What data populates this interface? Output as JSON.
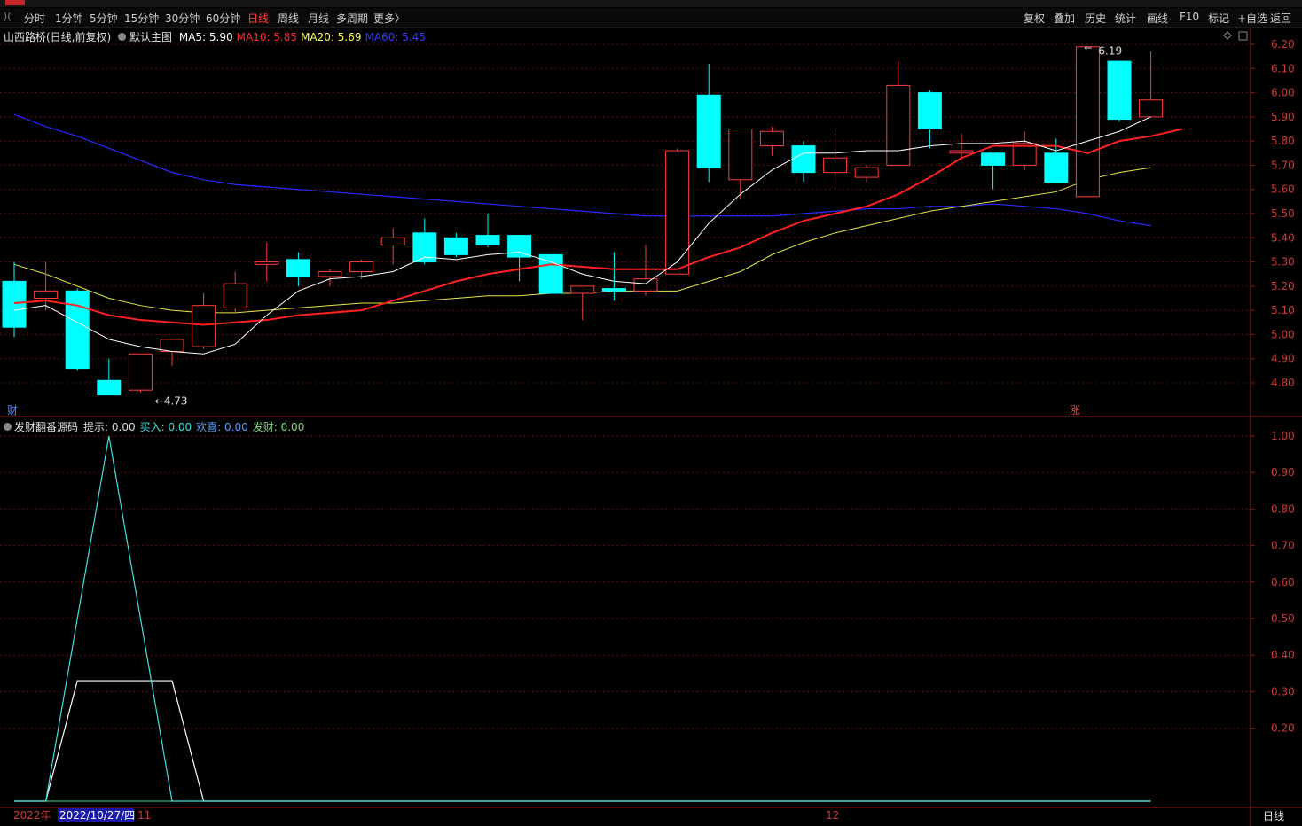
{
  "toolbar": {
    "back_label": "⟩(",
    "periods": [
      "分时",
      "1分钟",
      "5分钟",
      "15分钟",
      "30分钟",
      "60分钟",
      "日线",
      "周线",
      "月线",
      "多周期",
      "更多〉"
    ],
    "active_period": "日线",
    "right_buttons": [
      "复权",
      "叠加",
      "历史",
      "统计",
      "画线",
      "F10",
      "标记",
      "+自选",
      "返回"
    ]
  },
  "main_chart": {
    "stock_title": "山西路桥(日线,前复权)",
    "template_label": "默认主图",
    "ma": [
      {
        "label": "MA5: 5.90",
        "color": "#ffffff"
      },
      {
        "label": "MA10: 5.85",
        "color": "#ff2a2a"
      },
      {
        "label": "MA20: 5.69",
        "color": "#ffff55"
      },
      {
        "label": "MA60: 5.45",
        "color": "#3a3aff"
      }
    ],
    "high_label": "6.19",
    "low_label": "4.73",
    "marker_left": "财",
    "marker_right": "涨",
    "y_ticks": [
      "6.20",
      "6.10",
      "6.00",
      "5.90",
      "5.80",
      "5.70",
      "5.60",
      "5.50",
      "5.40",
      "5.30",
      "5.20",
      "5.10",
      "5.00",
      "4.90",
      "4.80"
    ]
  },
  "chart_data": {
    "type": "candlestick",
    "ylim": [
      4.7,
      6.22
    ],
    "candles": [
      {
        "o": 5.22,
        "h": 5.3,
        "l": 4.99,
        "c": 5.03
      },
      {
        "o": 5.15,
        "h": 5.3,
        "l": 5.1,
        "c": 5.18
      },
      {
        "o": 5.18,
        "h": 5.19,
        "l": 4.85,
        "c": 4.86
      },
      {
        "o": 4.81,
        "h": 4.9,
        "l": 4.75,
        "c": 4.75
      },
      {
        "o": 4.77,
        "h": 4.92,
        "l": 4.76,
        "c": 4.92
      },
      {
        "o": 4.93,
        "h": 4.98,
        "l": 4.87,
        "c": 4.98
      },
      {
        "o": 4.95,
        "h": 5.17,
        "l": 4.94,
        "c": 5.12
      },
      {
        "o": 5.11,
        "h": 5.26,
        "l": 5.09,
        "c": 5.21
      },
      {
        "o": 5.29,
        "h": 5.38,
        "l": 5.22,
        "c": 5.3
      },
      {
        "o": 5.31,
        "h": 5.34,
        "l": 5.2,
        "c": 5.24
      },
      {
        "o": 5.24,
        "h": 5.27,
        "l": 5.2,
        "c": 5.26
      },
      {
        "o": 5.26,
        "h": 5.31,
        "l": 5.23,
        "c": 5.3
      },
      {
        "o": 5.37,
        "h": 5.44,
        "l": 5.29,
        "c": 5.4
      },
      {
        "o": 5.42,
        "h": 5.48,
        "l": 5.29,
        "c": 5.3
      },
      {
        "o": 5.4,
        "h": 5.42,
        "l": 5.32,
        "c": 5.33
      },
      {
        "o": 5.41,
        "h": 5.5,
        "l": 5.36,
        "c": 5.37
      },
      {
        "o": 5.41,
        "h": 5.41,
        "l": 5.22,
        "c": 5.32
      },
      {
        "o": 5.33,
        "h": 5.33,
        "l": 5.17,
        "c": 5.17
      },
      {
        "o": 5.17,
        "h": 5.2,
        "l": 5.06,
        "c": 5.2
      },
      {
        "o": 5.19,
        "h": 5.34,
        "l": 5.14,
        "c": 5.18
      },
      {
        "o": 5.18,
        "h": 5.37,
        "l": 5.16,
        "c": 5.23
      },
      {
        "o": 5.25,
        "h": 5.77,
        "l": 5.25,
        "c": 5.76
      },
      {
        "o": 5.99,
        "h": 6.12,
        "l": 5.63,
        "c": 5.69
      },
      {
        "o": 5.64,
        "h": 5.85,
        "l": 5.56,
        "c": 5.85
      },
      {
        "o": 5.78,
        "h": 5.86,
        "l": 5.74,
        "c": 5.84
      },
      {
        "o": 5.78,
        "h": 5.8,
        "l": 5.63,
        "c": 5.67
      },
      {
        "o": 5.67,
        "h": 5.85,
        "l": 5.6,
        "c": 5.73
      },
      {
        "o": 5.65,
        "h": 5.7,
        "l": 5.63,
        "c": 5.69
      },
      {
        "o": 5.7,
        "h": 6.13,
        "l": 5.7,
        "c": 6.03
      },
      {
        "o": 6.0,
        "h": 6.01,
        "l": 5.77,
        "c": 5.85
      },
      {
        "o": 5.75,
        "h": 5.83,
        "l": 5.72,
        "c": 5.76
      },
      {
        "o": 5.75,
        "h": 5.75,
        "l": 5.6,
        "c": 5.7
      },
      {
        "o": 5.7,
        "h": 5.84,
        "l": 5.68,
        "c": 5.79
      },
      {
        "o": 5.75,
        "h": 5.81,
        "l": 5.63,
        "c": 5.63
      },
      {
        "o": 5.57,
        "h": 6.19,
        "l": 5.57,
        "c": 6.19
      },
      {
        "o": 6.13,
        "h": 6.13,
        "l": 5.88,
        "c": 5.89
      },
      {
        "o": 5.9,
        "h": 6.17,
        "l": 5.9,
        "c": 5.97
      }
    ],
    "ma5": [
      5.1,
      5.12,
      5.05,
      4.98,
      4.95,
      4.93,
      4.92,
      4.96,
      5.08,
      5.18,
      5.23,
      5.24,
      5.26,
      5.32,
      5.31,
      5.33,
      5.34,
      5.3,
      5.25,
      5.22,
      5.21,
      5.3,
      5.46,
      5.58,
      5.68,
      5.75,
      5.75,
      5.76,
      5.76,
      5.78,
      5.79,
      5.79,
      5.8,
      5.76,
      5.8,
      5.84,
      5.9
    ],
    "ma10": [
      5.13,
      5.14,
      5.12,
      5.08,
      5.06,
      5.05,
      5.04,
      5.05,
      5.06,
      5.08,
      5.09,
      5.1,
      5.14,
      5.18,
      5.22,
      5.25,
      5.27,
      5.29,
      5.28,
      5.27,
      5.27,
      5.27,
      5.32,
      5.36,
      5.42,
      5.47,
      5.5,
      5.53,
      5.58,
      5.65,
      5.73,
      5.78,
      5.78,
      5.78,
      5.75,
      5.8,
      5.82,
      5.85
    ],
    "ma20": [
      5.29,
      5.25,
      5.2,
      5.15,
      5.12,
      5.1,
      5.09,
      5.09,
      5.1,
      5.11,
      5.12,
      5.13,
      5.13,
      5.14,
      5.15,
      5.16,
      5.16,
      5.17,
      5.17,
      5.18,
      5.18,
      5.18,
      5.22,
      5.26,
      5.33,
      5.38,
      5.42,
      5.45,
      5.48,
      5.51,
      5.53,
      5.55,
      5.57,
      5.59,
      5.64,
      5.67,
      5.69
    ],
    "ma60": [
      5.91,
      5.86,
      5.82,
      5.77,
      5.72,
      5.67,
      5.64,
      5.62,
      5.61,
      5.6,
      5.59,
      5.58,
      5.57,
      5.56,
      5.55,
      5.54,
      5.53,
      5.52,
      5.51,
      5.5,
      5.49,
      5.49,
      5.49,
      5.49,
      5.49,
      5.5,
      5.51,
      5.52,
      5.52,
      5.53,
      5.53,
      5.54,
      5.53,
      5.52,
      5.5,
      5.47,
      5.45
    ]
  },
  "sub_chart": {
    "indicator_name": "发财翻番源码",
    "params": [
      {
        "label": "提示: 0.00",
        "color": "#dddddd"
      },
      {
        "label": "买入: 0.00",
        "color": "#40e0e0"
      },
      {
        "label": "欢喜: 0.00",
        "color": "#5aa0ff"
      },
      {
        "label": "发财: 0.00",
        "color": "#80dd80"
      }
    ],
    "y_ticks": [
      "1.00",
      "0.90",
      "0.80",
      "0.70",
      "0.60",
      "0.50",
      "0.40",
      "0.30",
      "0.20"
    ],
    "ylim": [
      0,
      1.0
    ],
    "tishi": [
      0,
      0,
      0.5,
      1.0,
      0.5,
      0,
      0,
      0,
      0,
      0,
      0,
      0,
      0,
      0,
      0,
      0,
      0,
      0,
      0,
      0,
      0,
      0,
      0,
      0,
      0,
      0,
      0,
      0,
      0,
      0,
      0,
      0,
      0,
      0,
      0,
      0,
      0
    ],
    "maru": [
      0,
      0,
      0.33,
      0.33,
      0.33,
      0.33,
      0,
      0,
      0,
      0,
      0,
      0,
      0,
      0,
      0,
      0,
      0,
      0,
      0,
      0,
      0,
      0,
      0,
      0,
      0,
      0,
      0,
      0,
      0,
      0,
      0,
      0,
      0,
      0,
      0,
      0,
      0
    ]
  },
  "x_axis": {
    "year_label": "2022年",
    "cursor_date": "2022/10/27/四",
    "month_11": "11",
    "month_12": "12",
    "period_label": "日线"
  }
}
